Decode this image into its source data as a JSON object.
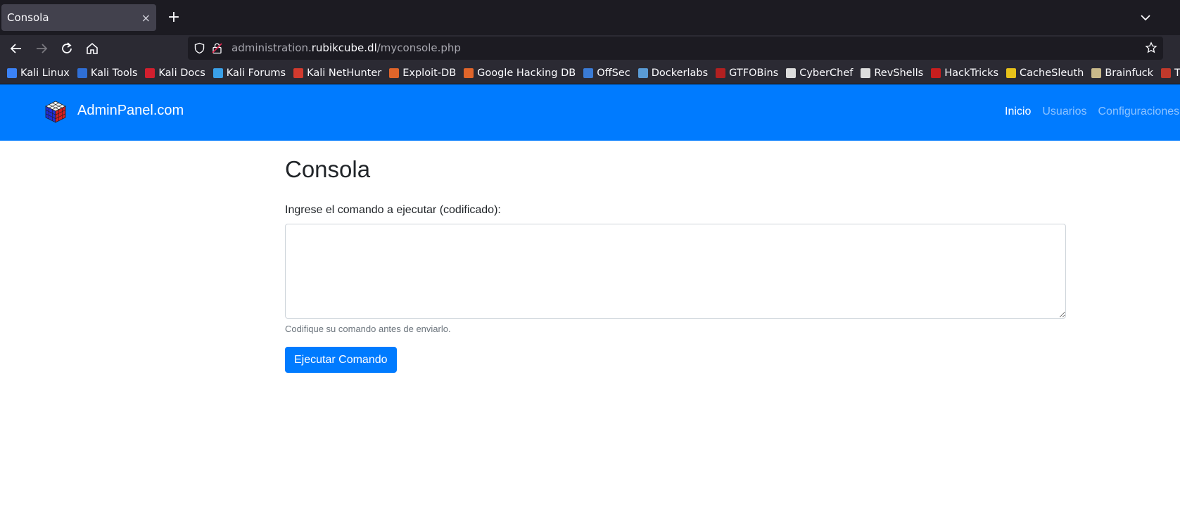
{
  "browser": {
    "tab_title": "Consola",
    "tab_close": "×",
    "new_tab": "+",
    "url": {
      "prefix": "administration.",
      "domain": "rubikcube.dl",
      "path": "/myconsole.php"
    }
  },
  "bookmarks": [
    {
      "label": "Kali Linux",
      "color": "#3b82f6"
    },
    {
      "label": "Kali Tools",
      "color": "#2f6fd6"
    },
    {
      "label": "Kali Docs",
      "color": "#d21f2e"
    },
    {
      "label": "Kali Forums",
      "color": "#3aa0e8"
    },
    {
      "label": "Kali NetHunter",
      "color": "#d23a2e"
    },
    {
      "label": "Exploit-DB",
      "color": "#e0652a"
    },
    {
      "label": "Google Hacking DB",
      "color": "#e0652a"
    },
    {
      "label": "OffSec",
      "color": "#3a7bd5"
    },
    {
      "label": "Dockerlabs",
      "color": "#5a9bd5"
    },
    {
      "label": "GTFOBins",
      "color": "#b32020"
    },
    {
      "label": "CyberChef",
      "color": "#dddddd"
    },
    {
      "label": "RevShells",
      "color": "#dddddd"
    },
    {
      "label": "HackTricks",
      "color": "#c81e1e"
    },
    {
      "label": "CacheSleuth",
      "color": "#e8c21a"
    },
    {
      "label": "Brainfuck",
      "color": "#c9b98a"
    },
    {
      "label": "TryHackMe",
      "color": "#c0392b"
    }
  ],
  "site": {
    "brand": "AdminPanel.com",
    "nav": {
      "inicio": "Inicio",
      "usuarios": "Usuarios",
      "configuraciones": "Configuraciones"
    },
    "primary_color": "#007bff"
  },
  "page": {
    "title": "Consola",
    "label": "Ingrese el comando a ejecutar (codificado):",
    "textarea_value": "",
    "help": "Codifique su comando antes de enviarlo.",
    "button": "Ejecutar Comando"
  }
}
